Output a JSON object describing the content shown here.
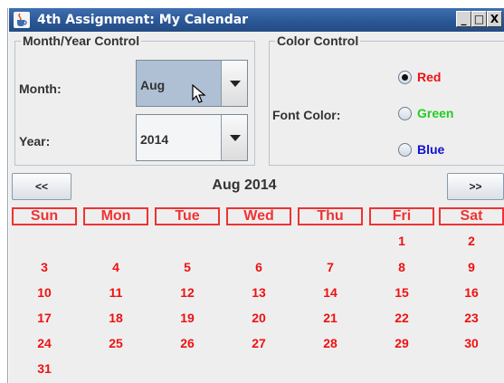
{
  "window": {
    "title": "4th Assignment: My Calendar",
    "controls": [
      "_",
      "□",
      "X"
    ]
  },
  "month_year_control": {
    "legend": "Month/Year Control",
    "month_label": "Month:",
    "month_value": "Aug",
    "year_label": "Year:",
    "year_value": "2014"
  },
  "color_control": {
    "legend": "Color Control",
    "font_color_label": "Font Color:",
    "options": [
      {
        "label": "Red",
        "color": "#ee1111",
        "selected": true
      },
      {
        "label": "Green",
        "color": "#22cc22",
        "selected": false
      },
      {
        "label": "Blue",
        "color": "#1111cc",
        "selected": false
      }
    ]
  },
  "calendar": {
    "prev_label": "<<",
    "next_label": ">>",
    "title": "Aug 2014",
    "day_names": [
      "Sun",
      "Mon",
      "Tue",
      "Wed",
      "Thu",
      "Fri",
      "Sat"
    ],
    "weeks": [
      [
        "",
        "",
        "",
        "",
        "",
        "1",
        "2"
      ],
      [
        "3",
        "4",
        "5",
        "6",
        "7",
        "8",
        "9"
      ],
      [
        "10",
        "11",
        "12",
        "13",
        "14",
        "15",
        "16"
      ],
      [
        "17",
        "18",
        "19",
        "20",
        "21",
        "22",
        "23"
      ],
      [
        "24",
        "25",
        "26",
        "27",
        "28",
        "29",
        "30"
      ],
      [
        "31",
        "",
        "",
        "",
        "",
        "",
        ""
      ]
    ],
    "font_color": "#ee1111"
  }
}
